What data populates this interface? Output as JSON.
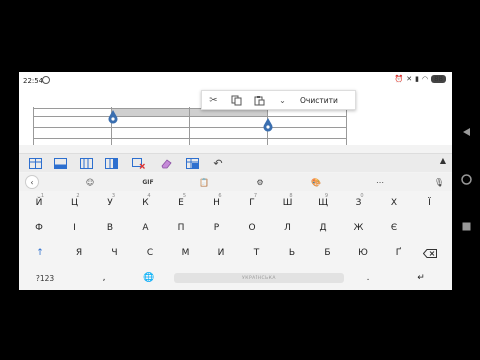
{
  "status_bar": {
    "time": "22:54",
    "battery": "88"
  },
  "context_menu": {
    "clear_label": "Очистити"
  },
  "keyboard": {
    "tools": {
      "gif_label": "GIF"
    },
    "rows": [
      {
        "keys": [
          {
            "char": "Й",
            "hint": "1"
          },
          {
            "char": "Ц",
            "hint": "2"
          },
          {
            "char": "У",
            "hint": "3"
          },
          {
            "char": "К",
            "hint": "4"
          },
          {
            "char": "Е",
            "hint": "5"
          },
          {
            "char": "Н",
            "hint": "6"
          },
          {
            "char": "Г",
            "hint": "7"
          },
          {
            "char": "Ш",
            "hint": "8"
          },
          {
            "char": "Щ",
            "hint": "9"
          },
          {
            "char": "З",
            "hint": "0"
          },
          {
            "char": "Х",
            "hint": ""
          },
          {
            "char": "Ї",
            "hint": ""
          }
        ]
      },
      {
        "keys": [
          {
            "char": "Ф"
          },
          {
            "char": "І"
          },
          {
            "char": "В"
          },
          {
            "char": "А"
          },
          {
            "char": "П"
          },
          {
            "char": "Р"
          },
          {
            "char": "О"
          },
          {
            "char": "Л"
          },
          {
            "char": "Д"
          },
          {
            "char": "Ж"
          },
          {
            "char": "Є"
          }
        ]
      },
      {
        "keys": [
          {
            "char": "Я"
          },
          {
            "char": "Ч"
          },
          {
            "char": "С"
          },
          {
            "char": "М"
          },
          {
            "char": "И"
          },
          {
            "char": "Т"
          },
          {
            "char": "Ь"
          },
          {
            "char": "Б"
          },
          {
            "char": "Ю"
          },
          {
            "char": "Ґ"
          }
        ]
      }
    ],
    "symbols_label": "?123",
    "comma_label": ",",
    "period_label": ".",
    "space_label": "УКРАЇНСЬКА"
  },
  "colors": {
    "accent": "#2d6fcf",
    "handle": "#3b6fb0",
    "keyboard_bg": "#f4f4f4",
    "toolbar_bg": "#ebebeb"
  }
}
